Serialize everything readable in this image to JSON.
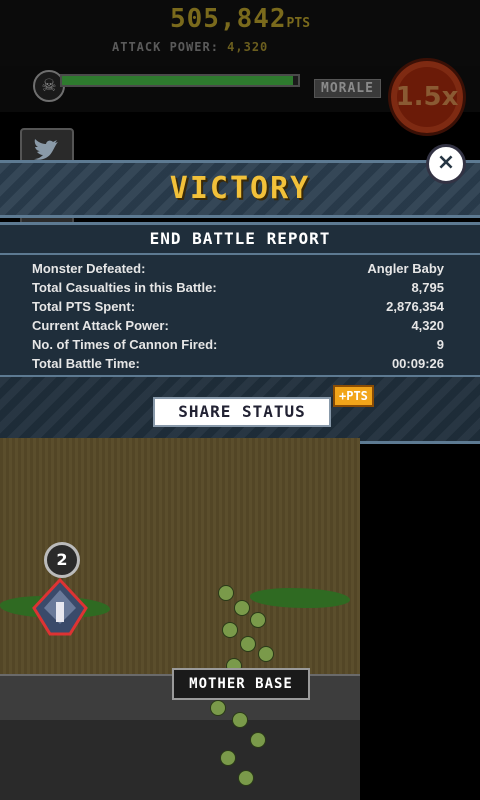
{
  "hud": {
    "points_value": "505,842",
    "points_unit": "PTS",
    "attack_label": "ATTACK POWER:",
    "attack_value": "4,320"
  },
  "monster": {
    "icon": "skull-icon",
    "health_fraction": 0.98,
    "health_color": "#2e7a2e"
  },
  "morale": {
    "label": "MORALE",
    "multiplier": "1.5x"
  },
  "side_buttons": {
    "twitter_icon": "twitter-bird-icon"
  },
  "result": {
    "title": "VICTORY",
    "title_color": "#f2c13a",
    "close_glyph": "×"
  },
  "report": {
    "header": "END BATTLE REPORT",
    "rows": [
      {
        "label": "Monster Defeated:",
        "value": "Angler Baby"
      },
      {
        "label": "Total Casualties in this Battle:",
        "value": "8,795"
      },
      {
        "label": "Total PTS Spent:",
        "value": "2,876,354"
      },
      {
        "label": "Current Attack Power:",
        "value": "4,320"
      },
      {
        "label": "No. of Times of Cannon Fired:",
        "value": "9"
      },
      {
        "label": "Total Battle Time:",
        "value": "00:09:26"
      }
    ],
    "share_label": "SHARE STATUS",
    "share_bonus": "+PTS"
  },
  "battlefield": {
    "unit_marker": "2",
    "base_label": "MOTHER BASE"
  }
}
